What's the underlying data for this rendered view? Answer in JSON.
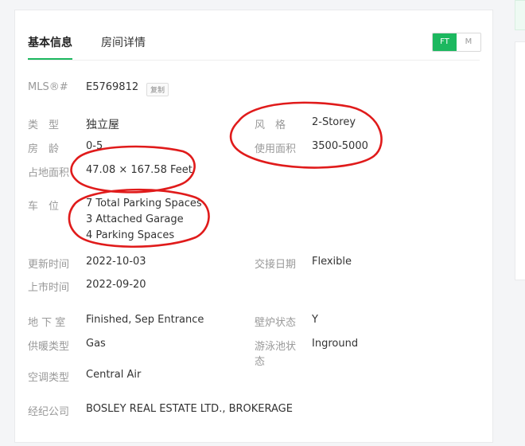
{
  "tabs": {
    "basic": "基本信息",
    "rooms": "房间详情"
  },
  "unit_toggle": {
    "ft": "FT",
    "m": "M",
    "active_color": "#1cb85f"
  },
  "mls": {
    "label": "MLS®#",
    "value": "E5769812",
    "copy_label": "复制"
  },
  "details": {
    "type": {
      "label": "类　型",
      "value": "独立屋"
    },
    "style": {
      "label": "风　格",
      "value": "2-Storey"
    },
    "age": {
      "label": "房　龄",
      "value": "0-5"
    },
    "area": {
      "label": "使用面积",
      "value": "3500-5000"
    },
    "lot": {
      "label": "占地面积",
      "value": "47.08 × 167.58 Feet"
    },
    "parking": {
      "label": "车　位",
      "lines": [
        "7 Total Parking Spaces",
        "3 Attached Garage",
        "4 Parking Spaces"
      ]
    },
    "updated": {
      "label": "更新时间",
      "value": "2022-10-03"
    },
    "handover": {
      "label": "交接日期",
      "value": "Flexible"
    },
    "listed": {
      "label": "上市时间",
      "value": "2022-09-20"
    },
    "basement": {
      "label": "地 下 室",
      "value": "Finished, Sep Entrance"
    },
    "fireplace": {
      "label": "壁炉状态",
      "value": "Y"
    },
    "heating": {
      "label": "供暖类型",
      "value": "Gas"
    },
    "pool": {
      "label_line1": "游泳池状",
      "label_line2": "态",
      "value": "Inground"
    },
    "ac": {
      "label": "空调类型",
      "value": "Central Air"
    },
    "brokerage": {
      "label": "经纪公司",
      "value": "BOSLEY REAL ESTATE LTD., BROKERAGE"
    }
  },
  "colors": {
    "accent": "#1cb85f",
    "annotation": "#e01b1b"
  }
}
